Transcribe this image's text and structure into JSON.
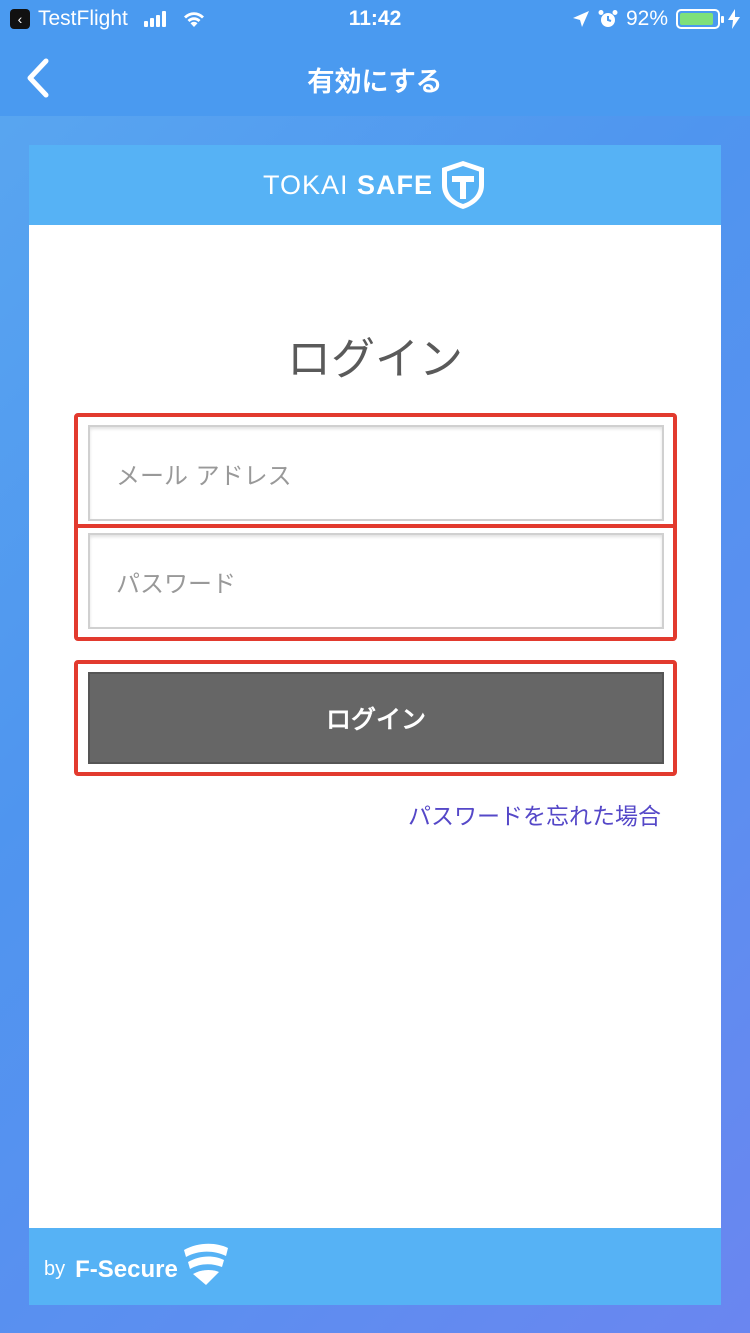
{
  "status_bar": {
    "app": "TestFlight",
    "time": "11:42",
    "battery": "92%",
    "battery_level": 0.92
  },
  "nav": {
    "title": "有効にする"
  },
  "header": {
    "brand_light": "TOKAI",
    "brand_bold": "SAFE"
  },
  "login": {
    "title": "ログイン",
    "email_placeholder": "メール アドレス",
    "password_placeholder": "パスワード",
    "button_label": "ログイン",
    "forgot_link": "パスワードを忘れた場合"
  },
  "footer": {
    "by": "by",
    "brand": "F-Secure"
  },
  "colors": {
    "accent": "#56b2f5",
    "highlight": "#e23a2e",
    "button": "#666666",
    "link": "#5548c8"
  }
}
